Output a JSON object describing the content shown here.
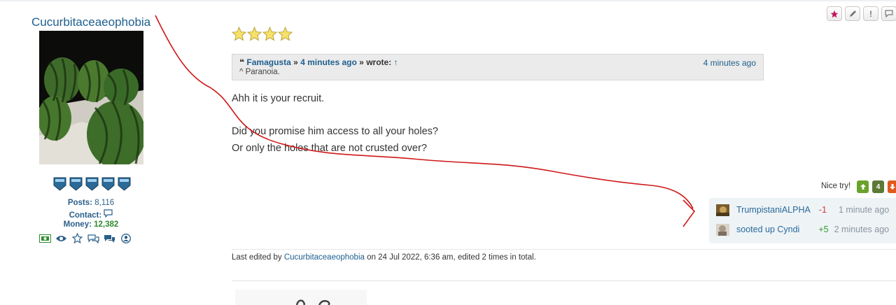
{
  "profile": {
    "username": "Cucurbitaceaeophobia",
    "posts_label": "Posts:",
    "posts_value": "8,116",
    "contact_label": "Contact:",
    "money_label": "Money:",
    "money_value": "12,382",
    "rank_icons": 5
  },
  "post": {
    "star_rating": 4,
    "quote": {
      "author": "Famagusta",
      "time_link": "4 minutes ago",
      "wrote": "wrote:",
      "time_right": "4 minutes ago",
      "text": "^ Paranoia."
    },
    "lines": [
      "Ahh it is your recruit.",
      "Did you promise him access to all your holes?",
      "Or only the holes that are not crusted over?"
    ]
  },
  "reactions": {
    "label": "Nice try!",
    "up_count": "4",
    "votes": [
      {
        "name": "TrumpistaniALPHA",
        "score": "-1",
        "time": "1 minute ago"
      },
      {
        "name": "sooted up Cyndi",
        "score": "+5",
        "time": "2 minutes ago"
      }
    ]
  },
  "edited": {
    "prefix": "Last edited by",
    "user": "Cucurbitaceaeophobia",
    "suffix": "on 24 Jul 2022, 6:36 am, edited 2 times in total."
  },
  "colors": {
    "link": "#1e5f8e",
    "annotation": "#d01818",
    "money": "#2f8a2f"
  }
}
